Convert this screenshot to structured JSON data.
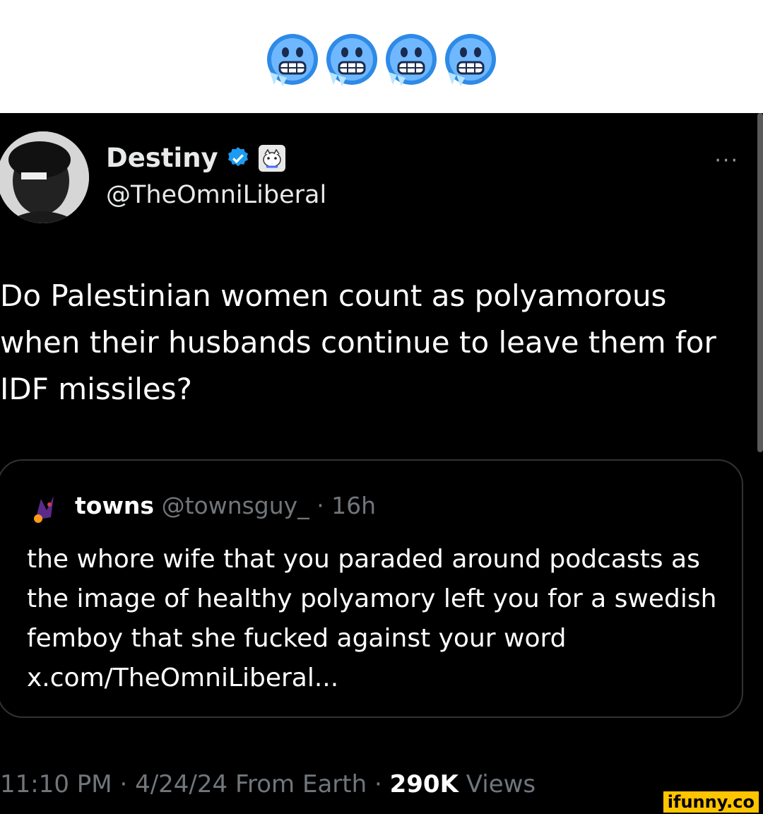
{
  "banner": {
    "emoji_count": 4,
    "emoji_name": "cold-face-emoji"
  },
  "tweet": {
    "display_name": "Destiny",
    "handle": "@TheOmniLiberal",
    "more_label": "···",
    "text": "Do Palestinian women count as polyamorous when their husbands continue to leave them for IDF missiles?",
    "quote": {
      "name": "towns",
      "handle": "@townsguy_",
      "time": "· 16h",
      "text": "the whore wife that you paraded around podcasts as the image of healthy polyamory left you for a swedish femboy that she fucked against your word x.com/TheOmniLiberal..."
    },
    "meta": {
      "time": "11:10 PM",
      "date": "· 4/24/24 From Earth ·",
      "views_count": "290K",
      "views_label": "Views"
    }
  },
  "watermark": "ifunny.co",
  "colors": {
    "verified": "#1d9bf0",
    "background": "#000000",
    "muted": "#71767b"
  }
}
